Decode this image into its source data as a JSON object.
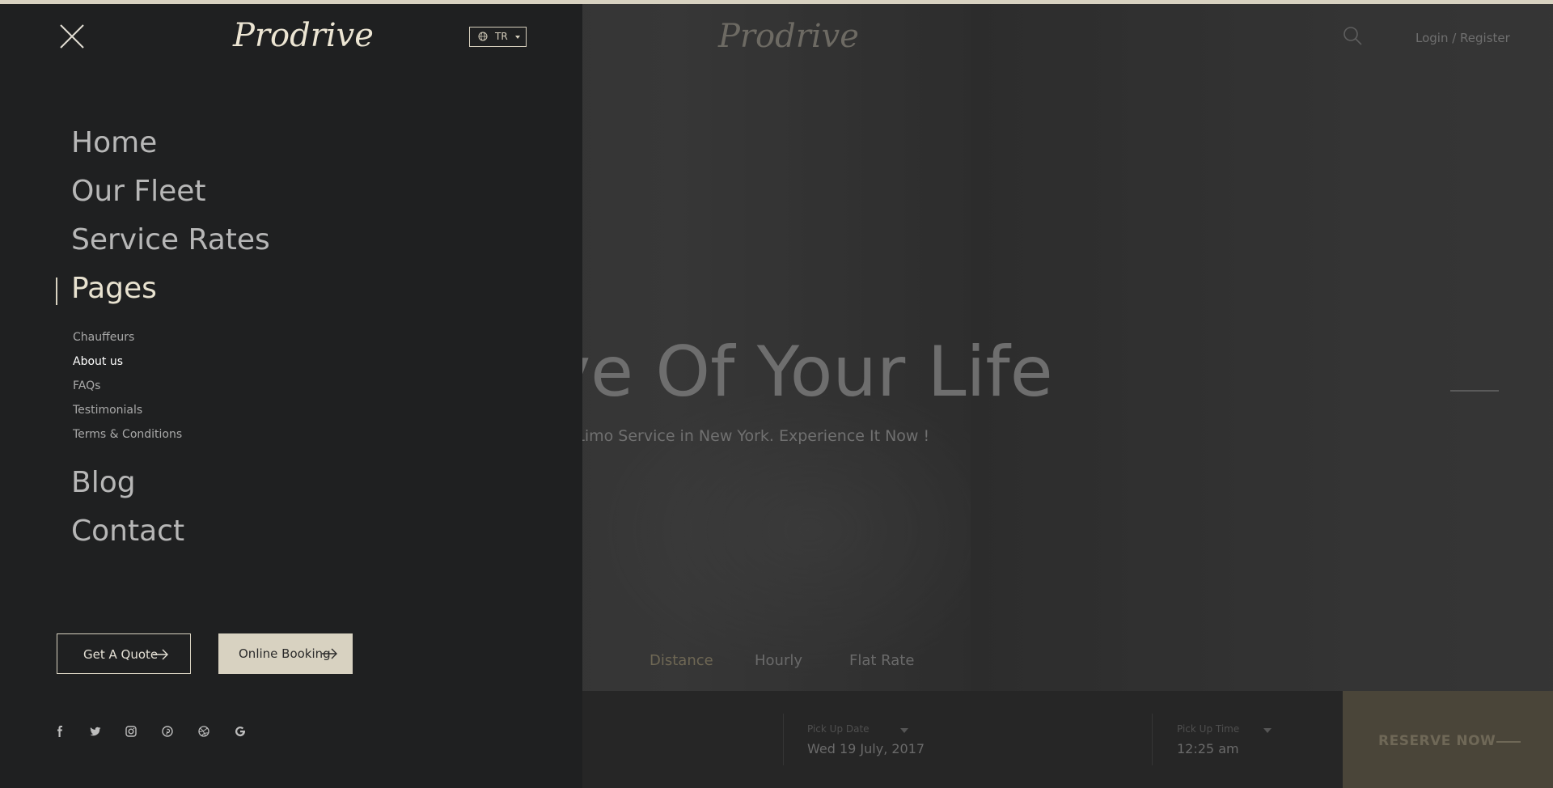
{
  "menu": {
    "logo": "Prodrive",
    "language": "TR",
    "nav": [
      {
        "label": "Home"
      },
      {
        "label": "Our Fleet"
      },
      {
        "label": "Service Rates"
      },
      {
        "label": "Pages"
      },
      {
        "label": "Blog"
      },
      {
        "label": "Contact"
      }
    ],
    "pages_submenu": [
      {
        "label": "Chauffeurs"
      },
      {
        "label": "About us"
      },
      {
        "label": "FAQs"
      },
      {
        "label": "Testimonials"
      },
      {
        "label": "Terms & Conditions"
      }
    ],
    "buttons": {
      "quote": "Get A Quote",
      "booking": "Online Booking"
    },
    "social_icons": [
      "facebook-icon",
      "twitter-icon",
      "instagram-icon",
      "pinterest-icon",
      "dribbble-icon",
      "google-icon"
    ]
  },
  "hero": {
    "logo": "Prodrive",
    "login": "Login / Register",
    "title": "rive Of Your Life",
    "subtitle": "ering the Best Limo Service in New York. Experience It Now !",
    "tabs": [
      "Distance",
      "Hourly",
      "Flat Rate"
    ],
    "fields": {
      "date_label": "Pick Up Date",
      "date_value": "Wed 19 July, 2017",
      "time_label": "Pick Up Time",
      "time_value": "12:25 am"
    },
    "reserve": "RESERVE NOW"
  },
  "colors": {
    "accent": "#d8d2c1",
    "menu_bg": "#1f2021"
  }
}
